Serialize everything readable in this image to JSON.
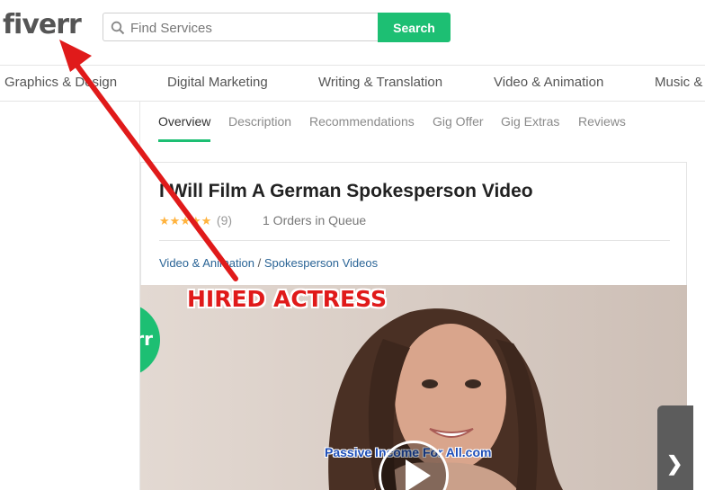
{
  "header": {
    "logo": "fiverr",
    "search_placeholder": "Find Services",
    "search_button": "Search",
    "search_icon": "search-icon"
  },
  "categories": [
    "Graphics & Design",
    "Digital Marketing",
    "Writing & Translation",
    "Video & Animation",
    "Music &"
  ],
  "gig_tabs": [
    "Overview",
    "Description",
    "Recommendations",
    "Gig Offer",
    "Gig Extras",
    "Reviews"
  ],
  "gig": {
    "title": "I Will Film A German Spokesperson Video",
    "stars": "★★★★★",
    "rating_count": "(9)",
    "queue": "1 Orders in Queue",
    "breadcrumb": {
      "category": "Video & Animation",
      "separator": "/",
      "subcategory": "Spokesperson Videos"
    }
  },
  "video": {
    "badge_text": "rr",
    "watermark": "Passive Income For All.com",
    "play_icon": "play-icon",
    "next_icon": "chevron-right-icon"
  },
  "annotation": {
    "label": "HIRED ACTRESS",
    "color": "#e01a1a"
  },
  "colors": {
    "brand_green": "#1dbf73",
    "link_blue": "#2a6496",
    "star_gold": "#ffb33e"
  }
}
